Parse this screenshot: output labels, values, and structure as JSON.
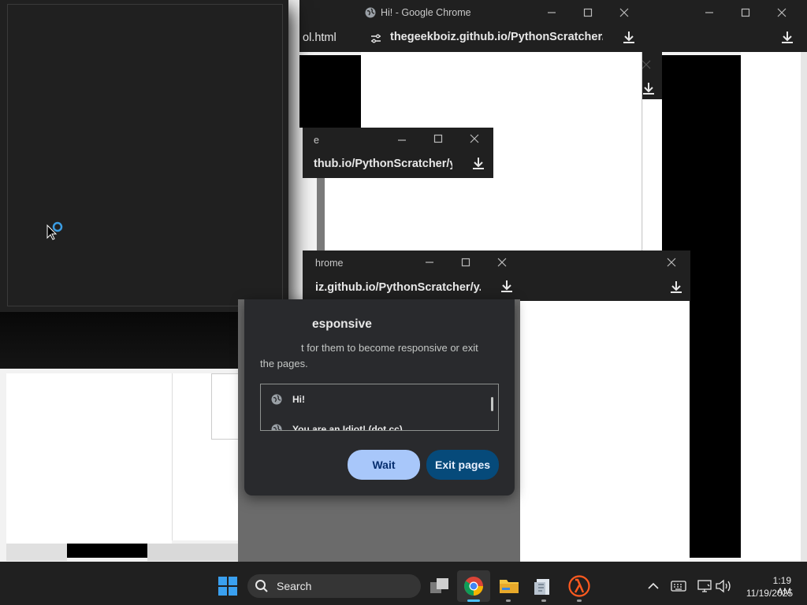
{
  "windows": {
    "front_chrome": {
      "title": "Hi! - Google Chrome",
      "url": "thegeekboiz.github.io/PythonScratcher/y..."
    },
    "back_right": {
      "url_fragment": "ol.html"
    },
    "mid_chrome": {
      "title_fragment": "e",
      "url": "thub.io/PythonScratcher/y..."
    },
    "lower_chrome": {
      "title_fragment": "hrome",
      "url": "iz.github.io/PythonScratcher/y..."
    }
  },
  "dialog": {
    "title_fragment": "esponsive",
    "body_line1": "t for them to become responsive or exit",
    "body_line2": "the pages.",
    "pages": [
      {
        "label": "Hi!"
      },
      {
        "label": "You are an Idiot! (dot cc)"
      }
    ],
    "wait_label": "Wait",
    "exit_label": "Exit pages"
  },
  "taskbar": {
    "search_label": "Search",
    "time": "1:19 AM",
    "date": "11/19/2025",
    "apps": [
      "task-view",
      "chrome",
      "file-explorer",
      "notepad",
      "half-life"
    ]
  },
  "colors": {
    "dark_bg": "#202020",
    "dialog_bg": "#292a2d",
    "wait_bg": "#a8c7fa",
    "exit_bg": "#0b57d0",
    "taskbar_bg": "#202020",
    "accent": "#0078d4"
  }
}
